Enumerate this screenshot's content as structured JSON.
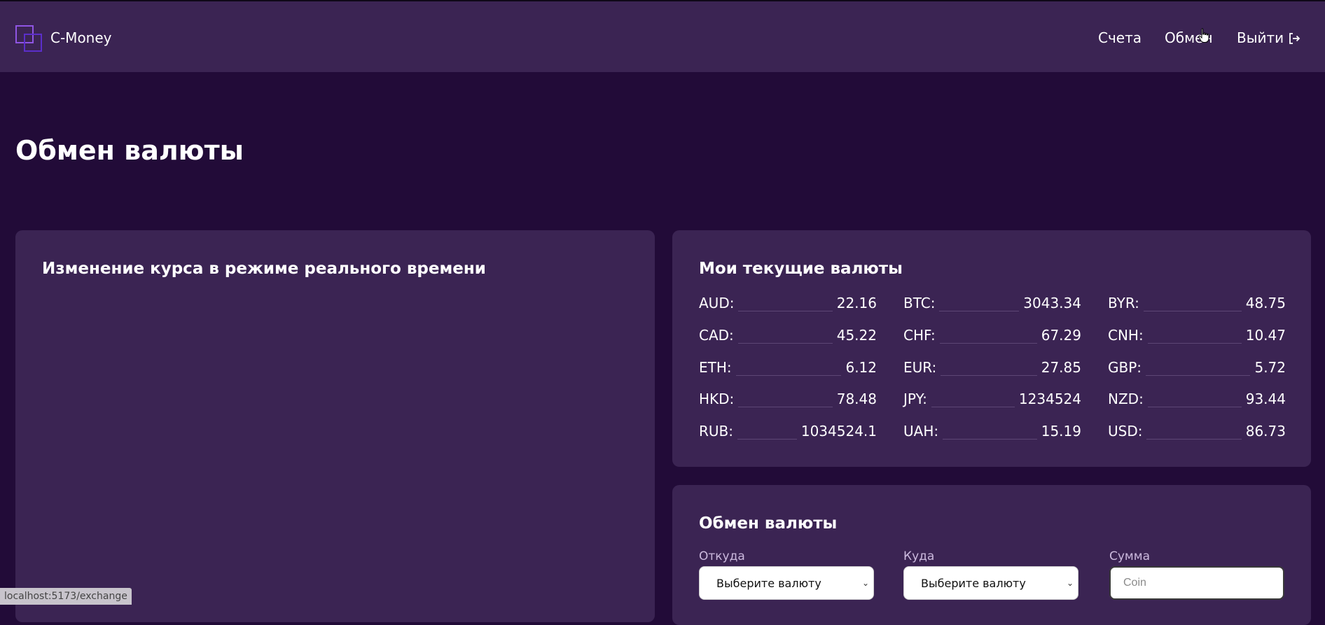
{
  "header": {
    "brand": "C-Money",
    "nav": {
      "accounts": "Счета",
      "exchange": "Обмен",
      "logout": "Выйти"
    }
  },
  "page": {
    "title": "Обмен валюты"
  },
  "realtime_card": {
    "title": "Изменение курса в режиме реального времени"
  },
  "balances_card": {
    "title": "Мои текущие валюты",
    "items": [
      {
        "code": "AUD:",
        "amount": "22.16"
      },
      {
        "code": "BTC:",
        "amount": "3043.34"
      },
      {
        "code": "BYR:",
        "amount": "48.75"
      },
      {
        "code": "CAD:",
        "amount": "45.22"
      },
      {
        "code": "CHF:",
        "amount": "67.29"
      },
      {
        "code": "CNH:",
        "amount": "10.47"
      },
      {
        "code": "ETH:",
        "amount": "6.12"
      },
      {
        "code": "EUR:",
        "amount": "27.85"
      },
      {
        "code": "GBP:",
        "amount": "5.72"
      },
      {
        "code": "HKD:",
        "amount": "78.48"
      },
      {
        "code": "JPY:",
        "amount": "1234524"
      },
      {
        "code": "NZD:",
        "amount": "93.44"
      },
      {
        "code": "RUB:",
        "amount": "1034524.1"
      },
      {
        "code": "UAH:",
        "amount": "15.19"
      },
      {
        "code": "USD:",
        "amount": "86.73"
      }
    ]
  },
  "exchange_card": {
    "title": "Обмен валюты",
    "from_label": "Откуда",
    "from_value": "Выберите валюту",
    "to_label": "Куда",
    "to_value": "Выберите валюту",
    "amount_label": "Сумма",
    "amount_placeholder": "Coin"
  },
  "status_bar": {
    "url": "localhost:5173/exchange"
  },
  "colors": {
    "background": "#220b38",
    "surface": "#3b2453",
    "logo_primary": "#8f55e3",
    "logo_secondary": "#5b2ec9"
  }
}
